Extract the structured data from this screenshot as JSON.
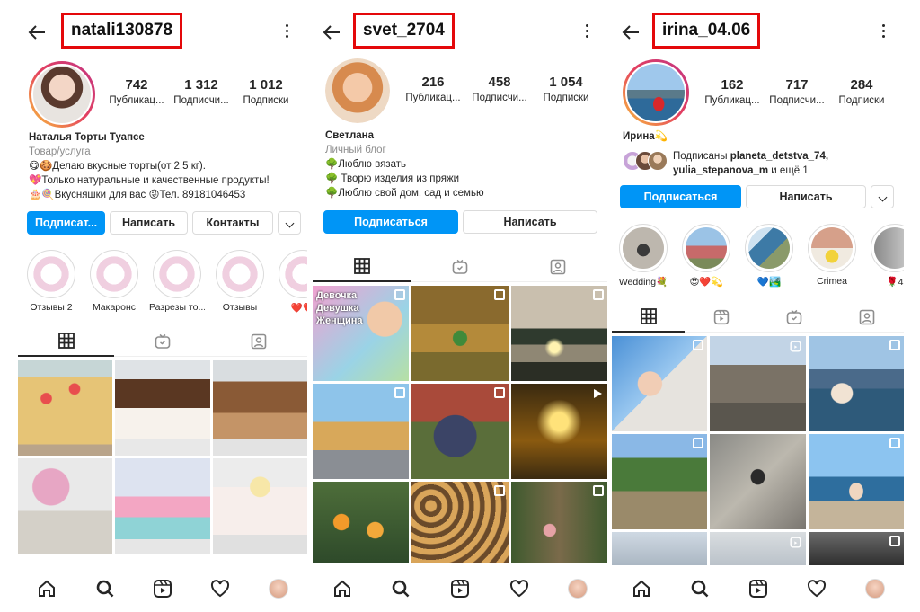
{
  "colors": {
    "accent": "#0095f6",
    "highlight_box": "#e4080a",
    "text": "#262626",
    "muted": "#8e8e8e"
  },
  "icons": [
    "back-arrow-icon",
    "more-vertical-icon",
    "grid-icon",
    "reels-icon",
    "igtv-icon",
    "tagged-icon",
    "home-icon",
    "search-icon",
    "heart-icon",
    "chevron-down-icon"
  ],
  "profiles": [
    {
      "username": "natali130878",
      "stats": [
        {
          "num": "742",
          "label": "Публикац..."
        },
        {
          "num": "1 312",
          "label": "Подписчи..."
        },
        {
          "num": "1 012",
          "label": "Подписки"
        }
      ],
      "name": "Наталья Торты Туапсе",
      "category": "Товар/услуга",
      "bio_lines": [
        "😋🍪Делаю вкусные  торты(от 2,5 кг).",
        "💖Только натуральные и качественные продукты!",
        "🎂🍭Вкусняшки для вас  😜Тел. 89181046453"
      ],
      "buttons": {
        "follow": "Подписат...",
        "message": "Написать",
        "contacts": "Контакты"
      },
      "highlights": [
        "Отзывы 2",
        "Макаронс",
        "Разрезы то...",
        "Отзывы",
        "❤️❤️"
      ]
    },
    {
      "username": "svet_2704",
      "stats": [
        {
          "num": "216",
          "label": "Публикац..."
        },
        {
          "num": "458",
          "label": "Подписчи..."
        },
        {
          "num": "1 054",
          "label": "Подписки"
        }
      ],
      "name": "Светлана",
      "category": "Личный блог",
      "bio_lines": [
        "🌳Люблю вязать",
        "🌳 Творю изделия из пряжи",
        "🌳Люблю свой дом, сад и семью"
      ],
      "buttons": {
        "follow": "Подписаться",
        "message": "Написать"
      },
      "post_caption": [
        "Девочка",
        "Девушка",
        "Женщина"
      ]
    },
    {
      "username": "irina_04.06",
      "stats": [
        {
          "num": "162",
          "label": "Публикац..."
        },
        {
          "num": "717",
          "label": "Подписчи..."
        },
        {
          "num": "284",
          "label": "Подписки"
        }
      ],
      "name": "Ирина💫",
      "followed_by_prefix": "Подписаны ",
      "followed_by_names": "planeta_detstva_74,",
      "followed_by_line2": "yulia_stepanova_m",
      "followed_by_suffix": " и ещё 1",
      "buttons": {
        "follow": "Подписаться",
        "message": "Написать"
      },
      "highlights": [
        "Wedding💐",
        "😍❤️💫",
        "💙🏞️",
        "Crimea",
        "🌹4"
      ]
    }
  ]
}
